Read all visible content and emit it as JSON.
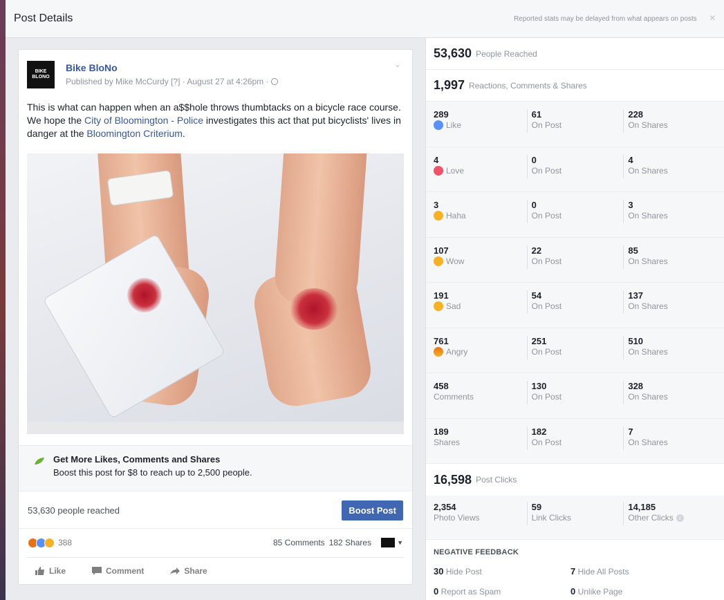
{
  "dialog": {
    "title": "Post Details",
    "note": "Reported stats may be delayed from what appears on posts",
    "close": "×"
  },
  "post": {
    "page_logo_text": "BIKE BLONO",
    "page_name": "Bike BloNo",
    "publish_line": "Published by Mike McCurdy [?] · August 27 at 4:26pm ·",
    "chevron": "⌄",
    "text_part1": "This is what can happen when an a$$hole throws thumbtacks on a bicycle race course. We hope the ",
    "link1": "City of Bloomington - Police",
    "text_part2": " investigates this act that put bicyclists' lives in danger at the ",
    "link2": "Bloomington Criterium",
    "text_part3": ".",
    "promo_title": "Get More Likes, Comments and Shares",
    "promo_sub": "Boost this post for $8 to reach up to 2,500 people.",
    "reach_text": "53,630 people reached",
    "boost_label": "Boost Post",
    "reaction_count": "388",
    "comments": "85 Comments",
    "shares": "182 Shares",
    "actions": {
      "like": "Like",
      "comment": "Comment",
      "share": "Share"
    }
  },
  "stats": {
    "reached_num": "53,630",
    "reached_label": "People Reached",
    "engagement_num": "1,997",
    "engagement_label": "Reactions, Comments & Shares",
    "rows": [
      {
        "total": "289",
        "label": "Like",
        "on_post": "61",
        "on_post_label": "On Post",
        "on_shares": "228",
        "on_shares_label": "On Shares"
      },
      {
        "total": "4",
        "label": "Love",
        "on_post": "0",
        "on_post_label": "On Post",
        "on_shares": "4",
        "on_shares_label": "On Shares"
      },
      {
        "total": "3",
        "label": "Haha",
        "on_post": "0",
        "on_post_label": "On Post",
        "on_shares": "3",
        "on_shares_label": "On Shares"
      },
      {
        "total": "107",
        "label": "Wow",
        "on_post": "22",
        "on_post_label": "On Post",
        "on_shares": "85",
        "on_shares_label": "On Shares"
      },
      {
        "total": "191",
        "label": "Sad",
        "on_post": "54",
        "on_post_label": "On Post",
        "on_shares": "137",
        "on_shares_label": "On Shares"
      },
      {
        "total": "761",
        "label": "Angry",
        "on_post": "251",
        "on_post_label": "On Post",
        "on_shares": "510",
        "on_shares_label": "On Shares"
      },
      {
        "total": "458",
        "label": "Comments",
        "on_post": "130",
        "on_post_label": "On Post",
        "on_shares": "328",
        "on_shares_label": "On Shares"
      },
      {
        "total": "189",
        "label": "Shares",
        "on_post": "182",
        "on_post_label": "On Post",
        "on_shares": "7",
        "on_shares_label": "On Shares"
      }
    ],
    "clicks_num": "16,598",
    "clicks_label": "Post Clicks",
    "photo_views": "2,354",
    "photo_views_label": "Photo Views",
    "link_clicks": "59",
    "link_clicks_label": "Link Clicks",
    "other_clicks": "14,185",
    "other_clicks_label": "Other Clicks",
    "neg_title": "NEGATIVE FEEDBACK",
    "hide_post_num": "30",
    "hide_post_label": "Hide Post",
    "hide_all_num": "7",
    "hide_all_label": "Hide All Posts",
    "spam_num": "0",
    "spam_label": "Report as Spam",
    "unlike_num": "0",
    "unlike_label": "Unlike Page"
  }
}
